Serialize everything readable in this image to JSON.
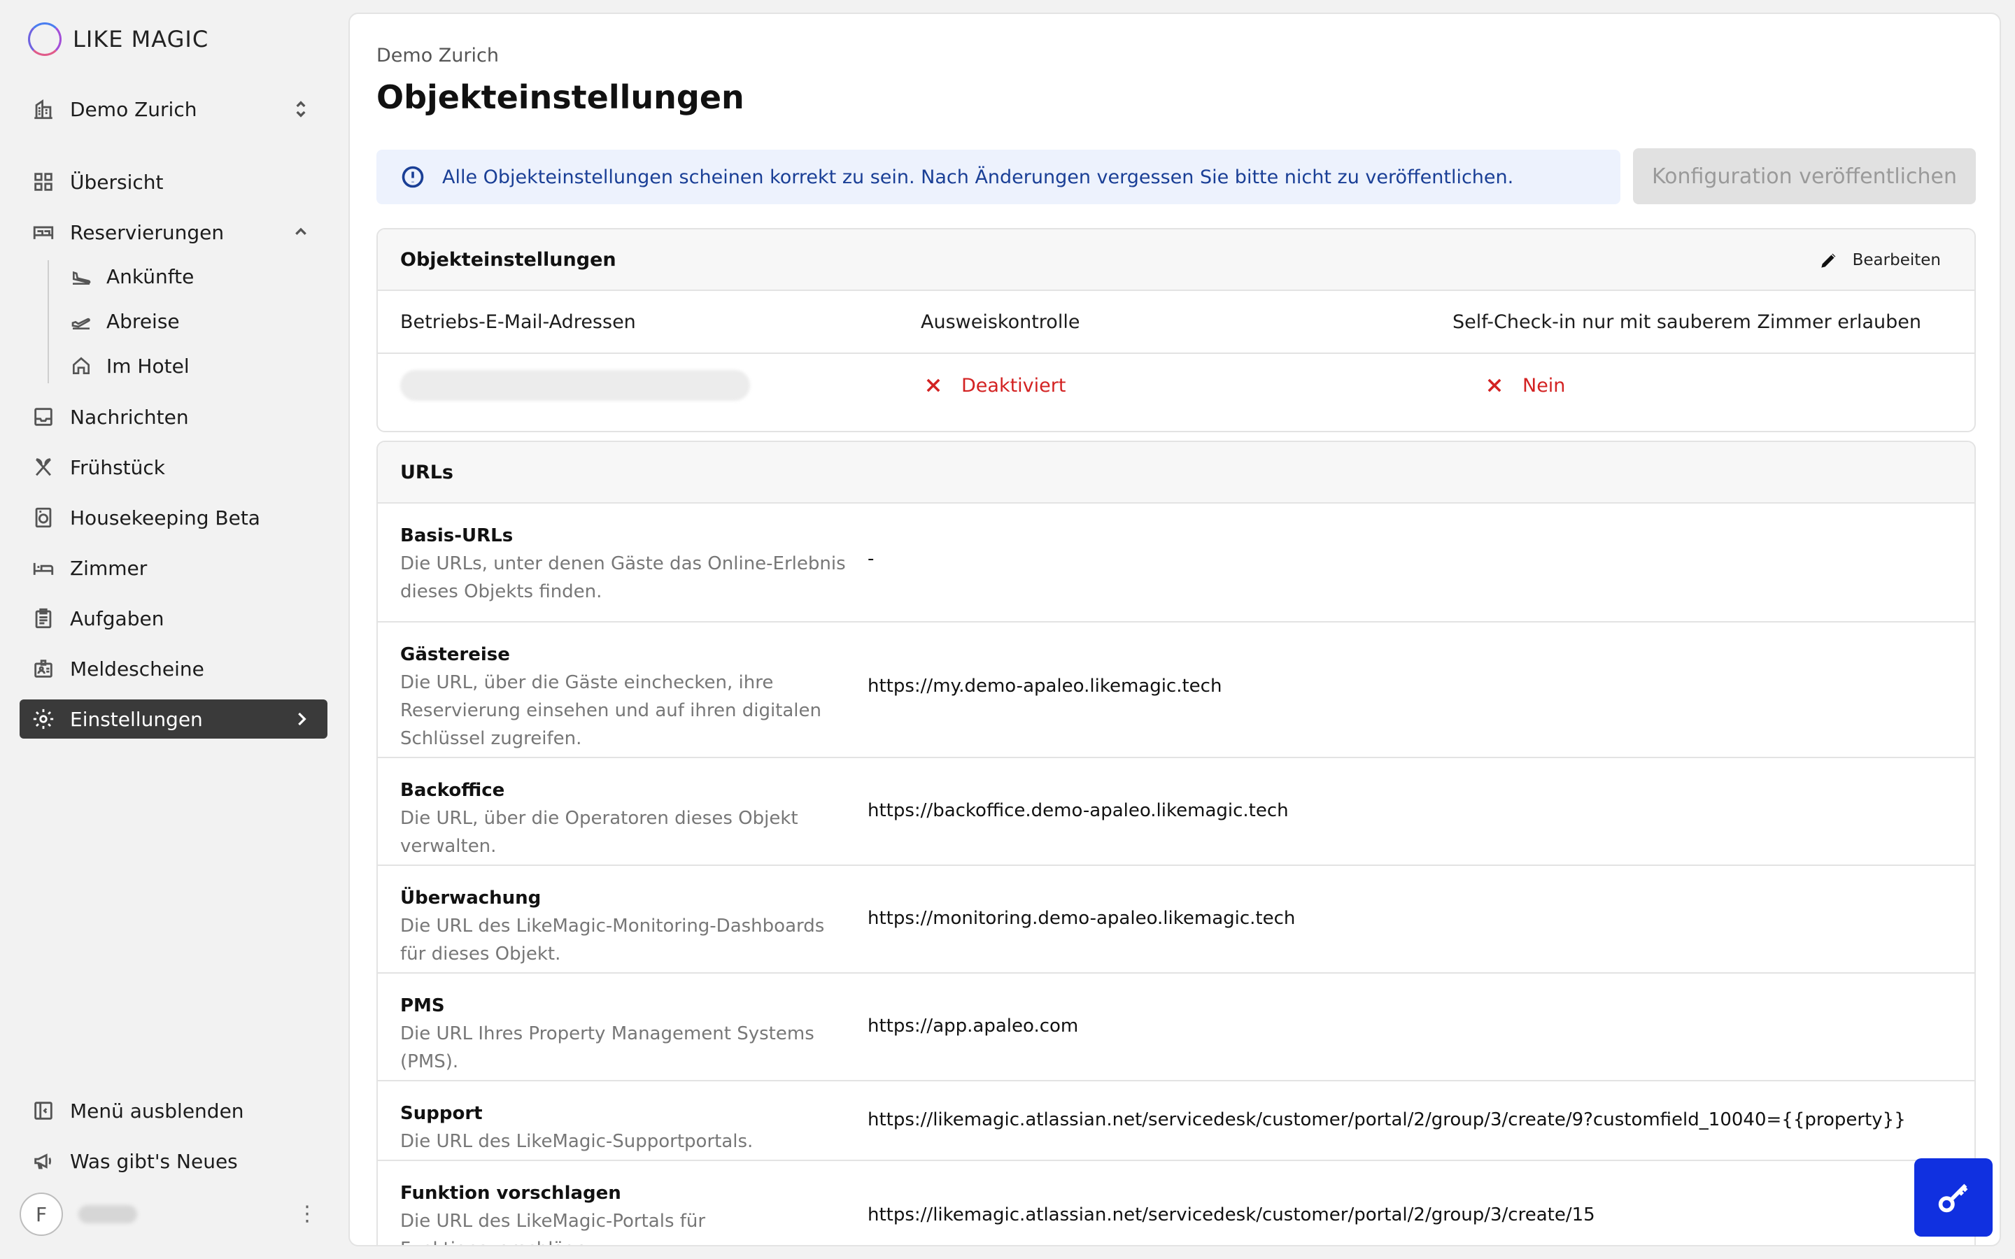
{
  "app": {
    "logo_text": "LIKE MAGIC"
  },
  "sidebar": {
    "property_selector": "Demo Zurich",
    "items": [
      {
        "label": "Übersicht",
        "icon": "grid-icon"
      },
      {
        "label": "Reservierungen",
        "icon": "bed-icon"
      },
      {
        "label": "Nachrichten",
        "icon": "inbox-icon"
      },
      {
        "label": "Frühstück",
        "icon": "cutlery-icon"
      },
      {
        "label": "Housekeeping Beta",
        "icon": "washing-machine-icon"
      },
      {
        "label": "Zimmer",
        "icon": "room-bed-icon"
      },
      {
        "label": "Aufgaben",
        "icon": "clipboard-icon"
      },
      {
        "label": "Meldescheine",
        "icon": "id-badge-icon"
      },
      {
        "label": "Einstellungen",
        "icon": "gear-icon"
      }
    ],
    "sub_items": [
      {
        "label": "Ankünfte",
        "icon": "plane-landing-icon"
      },
      {
        "label": "Abreise",
        "icon": "plane-takeoff-icon"
      },
      {
        "label": "Im Hotel",
        "icon": "home-icon"
      }
    ],
    "footer": {
      "collapse_label": "Menü ausblenden",
      "news_label": "Was gibt's Neues",
      "avatar_initial": "F"
    }
  },
  "main": {
    "breadcrumb": "Demo Zurich",
    "title": "Objekteinstellungen",
    "alert_text": "Alle Objekteinstellungen scheinen korrekt zu sein. Nach Änderungen vergessen Sie bitte nicht zu veröffentlichen.",
    "publish_label": "Konfiguration veröffentlichen",
    "settings_panel": {
      "title": "Objekteinstellungen",
      "edit_label": "Bearbeiten",
      "columns": [
        "Betriebs-E-Mail-Adressen",
        "Ausweiskontrolle",
        "Self-Check-in nur mit sauberem Zimmer erlauben"
      ],
      "id_check_value": "Deaktiviert",
      "clean_room_value": "Nein"
    },
    "urls_panel": {
      "title": "URLs",
      "rows": [
        {
          "title": "Basis-URLs",
          "desc": [
            "Die URLs, unter denen Gäste das Online-Erlebnis",
            "dieses Objekts finden."
          ],
          "value": "-"
        },
        {
          "title": "Gästereise",
          "desc": [
            "Die URL, über die Gäste einchecken, ihre",
            "Reservierung einsehen und auf ihren digitalen",
            "Schlüssel zugreifen."
          ],
          "value": "https://my.demo-apaleo.likemagic.tech"
        },
        {
          "title": "Backoffice",
          "desc": [
            "Die URL, über die Operatoren dieses Objekt",
            "verwalten."
          ],
          "value": "https://backoffice.demo-apaleo.likemagic.tech"
        },
        {
          "title": "Überwachung",
          "desc": [
            "Die URL des LikeMagic-Monitoring-Dashboards",
            "für dieses Objekt."
          ],
          "value": "https://monitoring.demo-apaleo.likemagic.tech"
        },
        {
          "title": "PMS",
          "desc": [
            "Die URL Ihres Property Management Systems",
            "(PMS)."
          ],
          "value": "https://app.apaleo.com"
        },
        {
          "title": "Support",
          "desc": [
            "Die URL des LikeMagic-Supportportals."
          ],
          "value": "https://likemagic.atlassian.net/servicedesk/customer/portal/2/group/3/create/9?customfield_10040={{property}}"
        },
        {
          "title": "Funktion vorschlagen",
          "desc": [
            "Die URL des LikeMagic-Portals für",
            "Funktionsvorschläge."
          ],
          "value": "https://likemagic.atlassian.net/servicedesk/customer/portal/2/group/3/create/15"
        }
      ]
    }
  },
  "colors": {
    "accent": "#1030e0",
    "active_nav": "#3a3a3a",
    "negative": "#d32222",
    "alert_bg": "#edf2fd",
    "alert_text": "#1a3f96"
  }
}
